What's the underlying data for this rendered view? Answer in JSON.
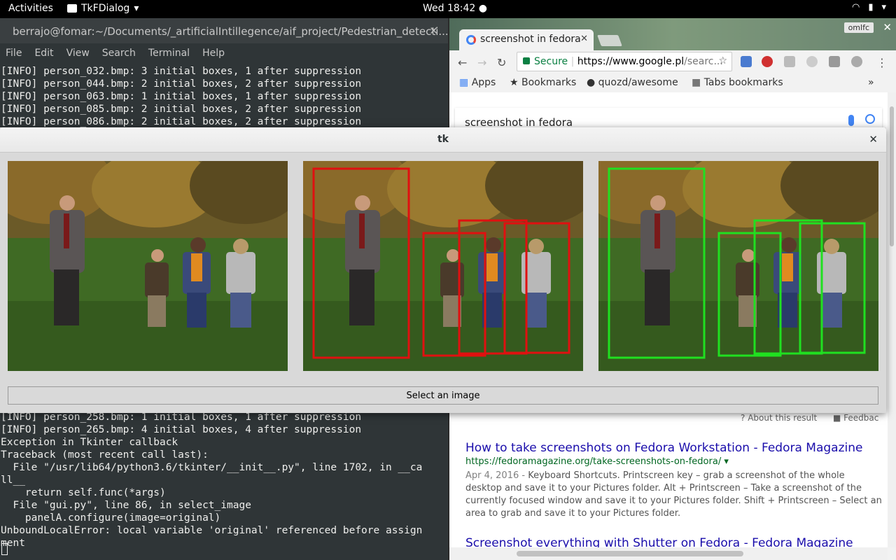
{
  "topbar": {
    "activities": "Activities",
    "app": "TkFDialog",
    "clock": "Wed 18:42"
  },
  "terminal": {
    "title": "berrajo@fomar:~/Documents/_artificialIntillegence/aif_project/Pedestrian_detecti...",
    "menu": [
      "File",
      "Edit",
      "View",
      "Search",
      "Terminal",
      "Help"
    ],
    "lines_top": [
      "[INFO] person_032.bmp: 3 initial boxes, 1 after suppression",
      "[INFO] person_044.bmp: 2 initial boxes, 2 after suppression",
      "[INFO] person_063.bmp: 1 initial boxes, 1 after suppression",
      "[INFO] person_085.bmp: 2 initial boxes, 2 after suppression",
      "[INFO] person_086.bmp: 2 initial boxes, 2 after suppression"
    ],
    "lines_bottom": [
      "[INFO] person_258.bmp: 1 initial boxes, 1 after suppression",
      "[INFO] person_265.bmp: 4 initial boxes, 4 after suppression",
      "Exception in Tkinter callback",
      "Traceback (most recent call last):",
      "  File \"/usr/lib64/python3.6/tkinter/__init__.py\", line 1702, in __ca",
      "ll__",
      "    return self.func(*args)",
      "  File \"gui.py\", line 86, in select_image",
      "    panelA.configure(image=original)",
      "UnboundLocalError: local variable 'original' referenced before assign",
      "ment"
    ]
  },
  "chrome": {
    "tab_title": "screenshot in fedora",
    "profile": "omlfc",
    "secure_label": "Secure",
    "url_host": "https://www.google.pl",
    "url_rest": "/searc...",
    "bookmarks": [
      "Apps",
      "Bookmarks",
      "quozd/awesome",
      "Tabs bookmarks"
    ],
    "overflow": "»",
    "search_query": "screenshot in fedora",
    "about_result": "About this result",
    "feedback": "Feedbac",
    "result1_title": "How to take screenshots on Fedora Workstation - Fedora Magazine",
    "result1_url": "https://fedoramagazine.org/take-screenshots-on-fedora/",
    "result1_date": "Apr 4, 2016 - ",
    "result1_snippet": "Keyboard Shortcuts. Printscreen key – grab a screenshot of the whole desktop and save it to your Pictures folder. Alt + Printscreen – Take a screenshot of the currently focused window and save it to your Pictures folder. Shift + Printscreen – Select an area to grab and save it to your Pictures folder.",
    "result2_title": "Screenshot everything with Shutter on Fedora - Fedora Magazine"
  },
  "tkdialog": {
    "title": "tk",
    "select_button": "Select an image",
    "panels": [
      {
        "name": "original",
        "box_color": ""
      },
      {
        "name": "before-suppression",
        "box_color": "#e01010"
      },
      {
        "name": "after-suppression",
        "box_color": "#20e020"
      }
    ]
  },
  "colors": {
    "terminal_bg": "#2f3537",
    "dialog_bg": "#d9d9d9",
    "link": "#1a0dab",
    "url_green": "#006621"
  }
}
